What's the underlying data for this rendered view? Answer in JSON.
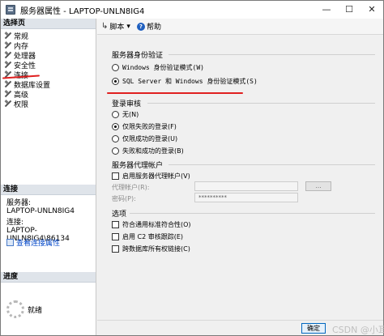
{
  "window": {
    "title": "服务器属性 - LAPTOP-UNLN8IG4",
    "minimize": "—",
    "maximize": "☐",
    "close": "✕"
  },
  "left": {
    "pages_header": "选择页",
    "pages": [
      "常规",
      "内存",
      "处理器",
      "安全性",
      "连接",
      "数据库设置",
      "高级",
      "权限"
    ],
    "selected_page": "安全性",
    "connection_header": "连接",
    "server_label": "服务器:",
    "server_value": "LAPTOP-UNLN8IG4",
    "connection_label": "连接:",
    "connection_value": "LAPTOP-UNLN8IG4\\86134",
    "view_conn_props": "查看连接属性",
    "progress_header": "进度",
    "progress_status": "就绪"
  },
  "toolbar": {
    "script_label": "脚本",
    "dropdown_arrow": "▾",
    "help_label": "帮助"
  },
  "auth": {
    "group_label": "服务器身份验证",
    "options": [
      {
        "label": "Windows 身份验证模式(W)",
        "checked": false
      },
      {
        "label": "SQL Server 和 Windows 身份验证模式(S)",
        "checked": true
      }
    ]
  },
  "audit": {
    "group_label": "登录审核",
    "options": [
      {
        "label": "无(N)",
        "checked": false
      },
      {
        "label": "仅限失败的登录(F)",
        "checked": true
      },
      {
        "label": "仅限成功的登录(U)",
        "checked": false
      },
      {
        "label": "失败和成功的登录(B)",
        "checked": false
      }
    ]
  },
  "proxy": {
    "group_label": "服务器代理帐户",
    "enable_label": "启用服务器代理帐户(V)",
    "account_label": "代理帐户(R):",
    "account_value": "",
    "password_label": "密码(P):",
    "password_value": "**********",
    "browse_label": "..."
  },
  "options": {
    "group_label": "选项",
    "items": [
      {
        "label": "符合通用标准符合性(O)",
        "checked": false
      },
      {
        "label": "启用 C2 审核跟踪(E)",
        "checked": false
      },
      {
        "label": "跨数据库所有权链接(C)",
        "checked": false
      }
    ]
  },
  "footer": {
    "ok_label": "确定",
    "watermark": "CSDN @小耳白"
  }
}
